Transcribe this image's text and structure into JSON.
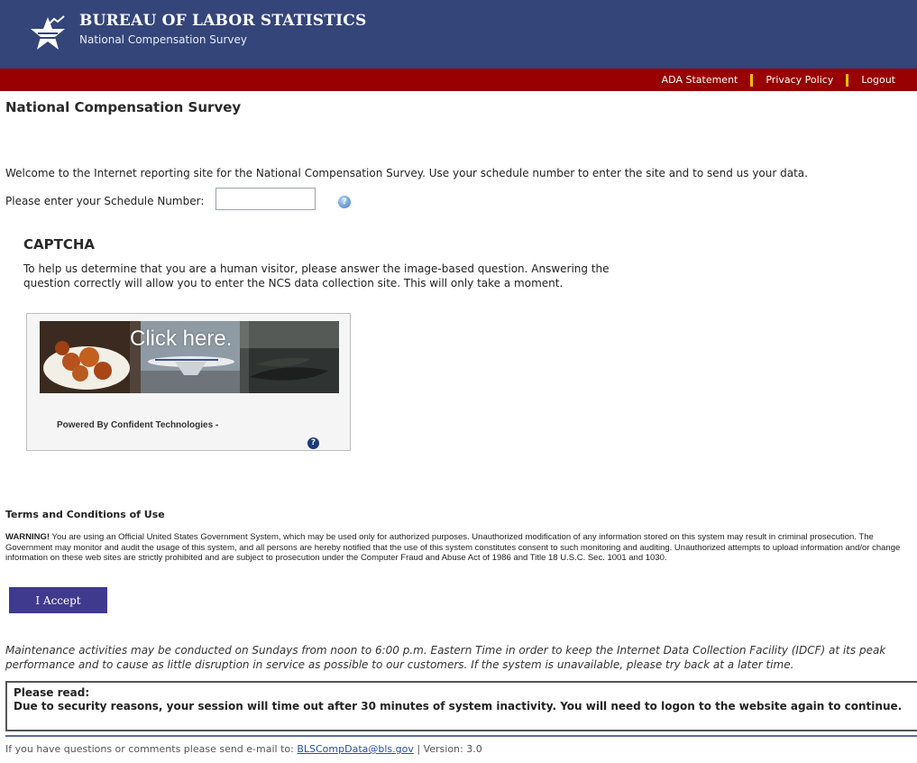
{
  "header": {
    "agency_name": "BUREAU OF LABOR STATISTICS",
    "survey_name": "National Compensation Survey",
    "logo_icon": "bls-star-logo-icon"
  },
  "topnav": {
    "ada": "ADA Statement",
    "privacy": "Privacy Policy",
    "logout": "Logout"
  },
  "page": {
    "title": "National Compensation Survey",
    "welcome": "Welcome to the Internet reporting site for the National Compensation Survey. Use your schedule number to enter the site and to send us your data.",
    "schedule_label": "Please enter your Schedule Number:",
    "schedule_value": "",
    "help_icon": "help-icon"
  },
  "captcha": {
    "heading": "CAPTCHA",
    "description": "To help us determine that you are a human visitor, please answer the image-based question. Answering the question correctly will allow you to enter the NCS data collection site. This will only take a moment.",
    "cta": "Click here.",
    "powered_by": "Powered By Confident Technologies  -",
    "help_icon": "question-icon"
  },
  "terms": {
    "heading": "Terms and Conditions of Use",
    "warning_label": "WARNING!",
    "warning_text": " You are using an Official United States Government System, which may be used only for authorized purposes. Unauthorized modification of any information stored on this system may result in criminal prosecution. The Government may monitor and audit the usage of this system, and all persons are hereby notified that the use of this system constitutes consent to such monitoring and auditing. Unauthorized attempts to upload information and/or change information on these web sites are strictly prohibited and are subject to prosecution under the Computer Fraud and Abuse Act of 1986 and Title 18 U.S.C. Sec. 1001 and 1030.",
    "accept_label": "I Accept"
  },
  "maintenance": "Maintenance activities may be conducted on Sundays from noon to 6:00 p.m. Eastern Time in order to keep the Internet Data Collection Facility (IDCF) at its peak performance and to cause as little disruption in service as possible to our customers. If the system is unavailable, please try back at a later time.",
  "notice": {
    "title": "Please read:",
    "text": "Due to security reasons, your session will time out after 30 minutes of system inactivity. You will need to logon to the website again to continue."
  },
  "footer": {
    "prefix": "If you have questions or comments please send e-mail to: ",
    "email": "BLSCompData@bls.gov",
    "version": " | Version: 3.0"
  },
  "colors": {
    "header_blue": "#34457a",
    "nav_red": "#990000",
    "separator_yellow": "#f2c200",
    "button_purple": "#3f3a8e"
  }
}
